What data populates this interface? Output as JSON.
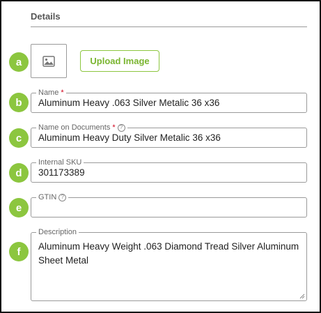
{
  "section": {
    "title": "Details"
  },
  "image_upload": {
    "button_label": "Upload Image"
  },
  "badges": [
    "a",
    "b",
    "c",
    "d",
    "e",
    "f"
  ],
  "fields": {
    "name": {
      "label": "Name",
      "required_mark": "*",
      "value": "Aluminum Heavy .063 Silver Metalic 36 x36"
    },
    "name_on_documents": {
      "label": "Name on Documents",
      "required_mark": "*",
      "help": "?",
      "value": "Aluminum Heavy Duty Silver Metalic 36 x36"
    },
    "internal_sku": {
      "label": "Internal SKU",
      "value": "301173389"
    },
    "gtin": {
      "label": "GTIN",
      "help": "?",
      "value": ""
    },
    "description": {
      "label": "Description",
      "value": "Aluminum Heavy Weight .063  Diamond Tread Silver Aluminum Sheet Metal"
    }
  },
  "colors": {
    "accent": "#8cc63f",
    "required": "#d0021b",
    "border": "#9a9a9a"
  }
}
